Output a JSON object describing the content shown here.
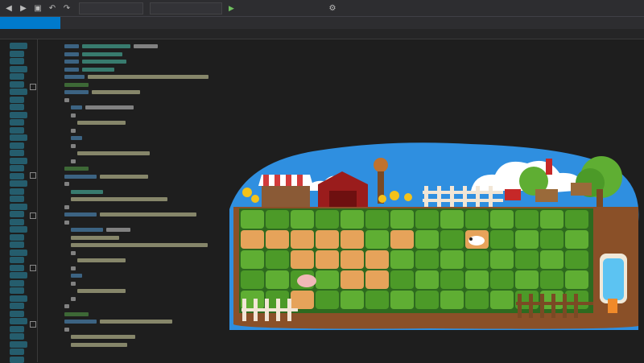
{
  "toolbar": {
    "config_value": "",
    "start_label": "",
    "icons": [
      "back-icon",
      "forward-icon",
      "save-icon",
      "undo-icon",
      "redo-icon",
      "start-icon",
      "settings-icon"
    ]
  },
  "tabs": [
    {
      "label": ""
    },
    {
      "label": ""
    },
    {
      "label": ""
    },
    {
      "label": ""
    }
  ],
  "breadcrumb": {
    "left": "",
    "middle": "",
    "right": ""
  },
  "game": {
    "name": "farm-garden-preview",
    "colors": {
      "sky": "#2f8fe0",
      "grass_dark": "#2e6a1f",
      "grass_light": "#5fae33",
      "soil": "#e6a35a",
      "fence": "#f2e6d6",
      "barn": "#9a1c1c"
    }
  }
}
